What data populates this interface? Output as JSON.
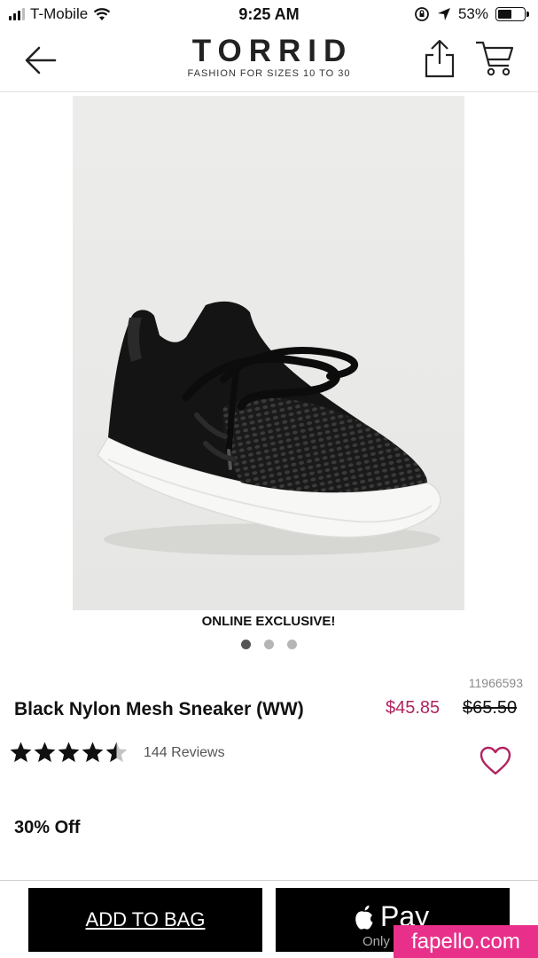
{
  "status_bar": {
    "carrier": "T-Mobile",
    "time": "9:25 AM",
    "battery": "53%",
    "battery_level": 0.53
  },
  "header": {
    "brand": "TORRID",
    "tagline": "FASHION FOR SIZES 10 TO 30",
    "icons": [
      "back-arrow-icon",
      "share-icon",
      "cart-icon"
    ]
  },
  "gallery": {
    "badge": "ONLINE EXCLUSIVE!",
    "image_count": 3,
    "active_index": 0
  },
  "product": {
    "sku": "11966593",
    "name": "Black Nylon Mesh Sneaker (WW)",
    "sale_price": "$45.85",
    "original_price": "$65.50",
    "rating": 4.5,
    "rating_max": 5,
    "reviews": "144 Reviews",
    "discount": "30% Off"
  },
  "actions": {
    "add_to_bag": "ADD TO BAG",
    "apple_pay": "Pay",
    "apple_pay_sub": "Only"
  },
  "watermark": "fapello.com",
  "colors": {
    "sale_price": "#b0245f",
    "button_bg": "#000000",
    "watermark_bg": "#e8308a",
    "star": "#111111",
    "star_empty": "#c4c4c4"
  }
}
